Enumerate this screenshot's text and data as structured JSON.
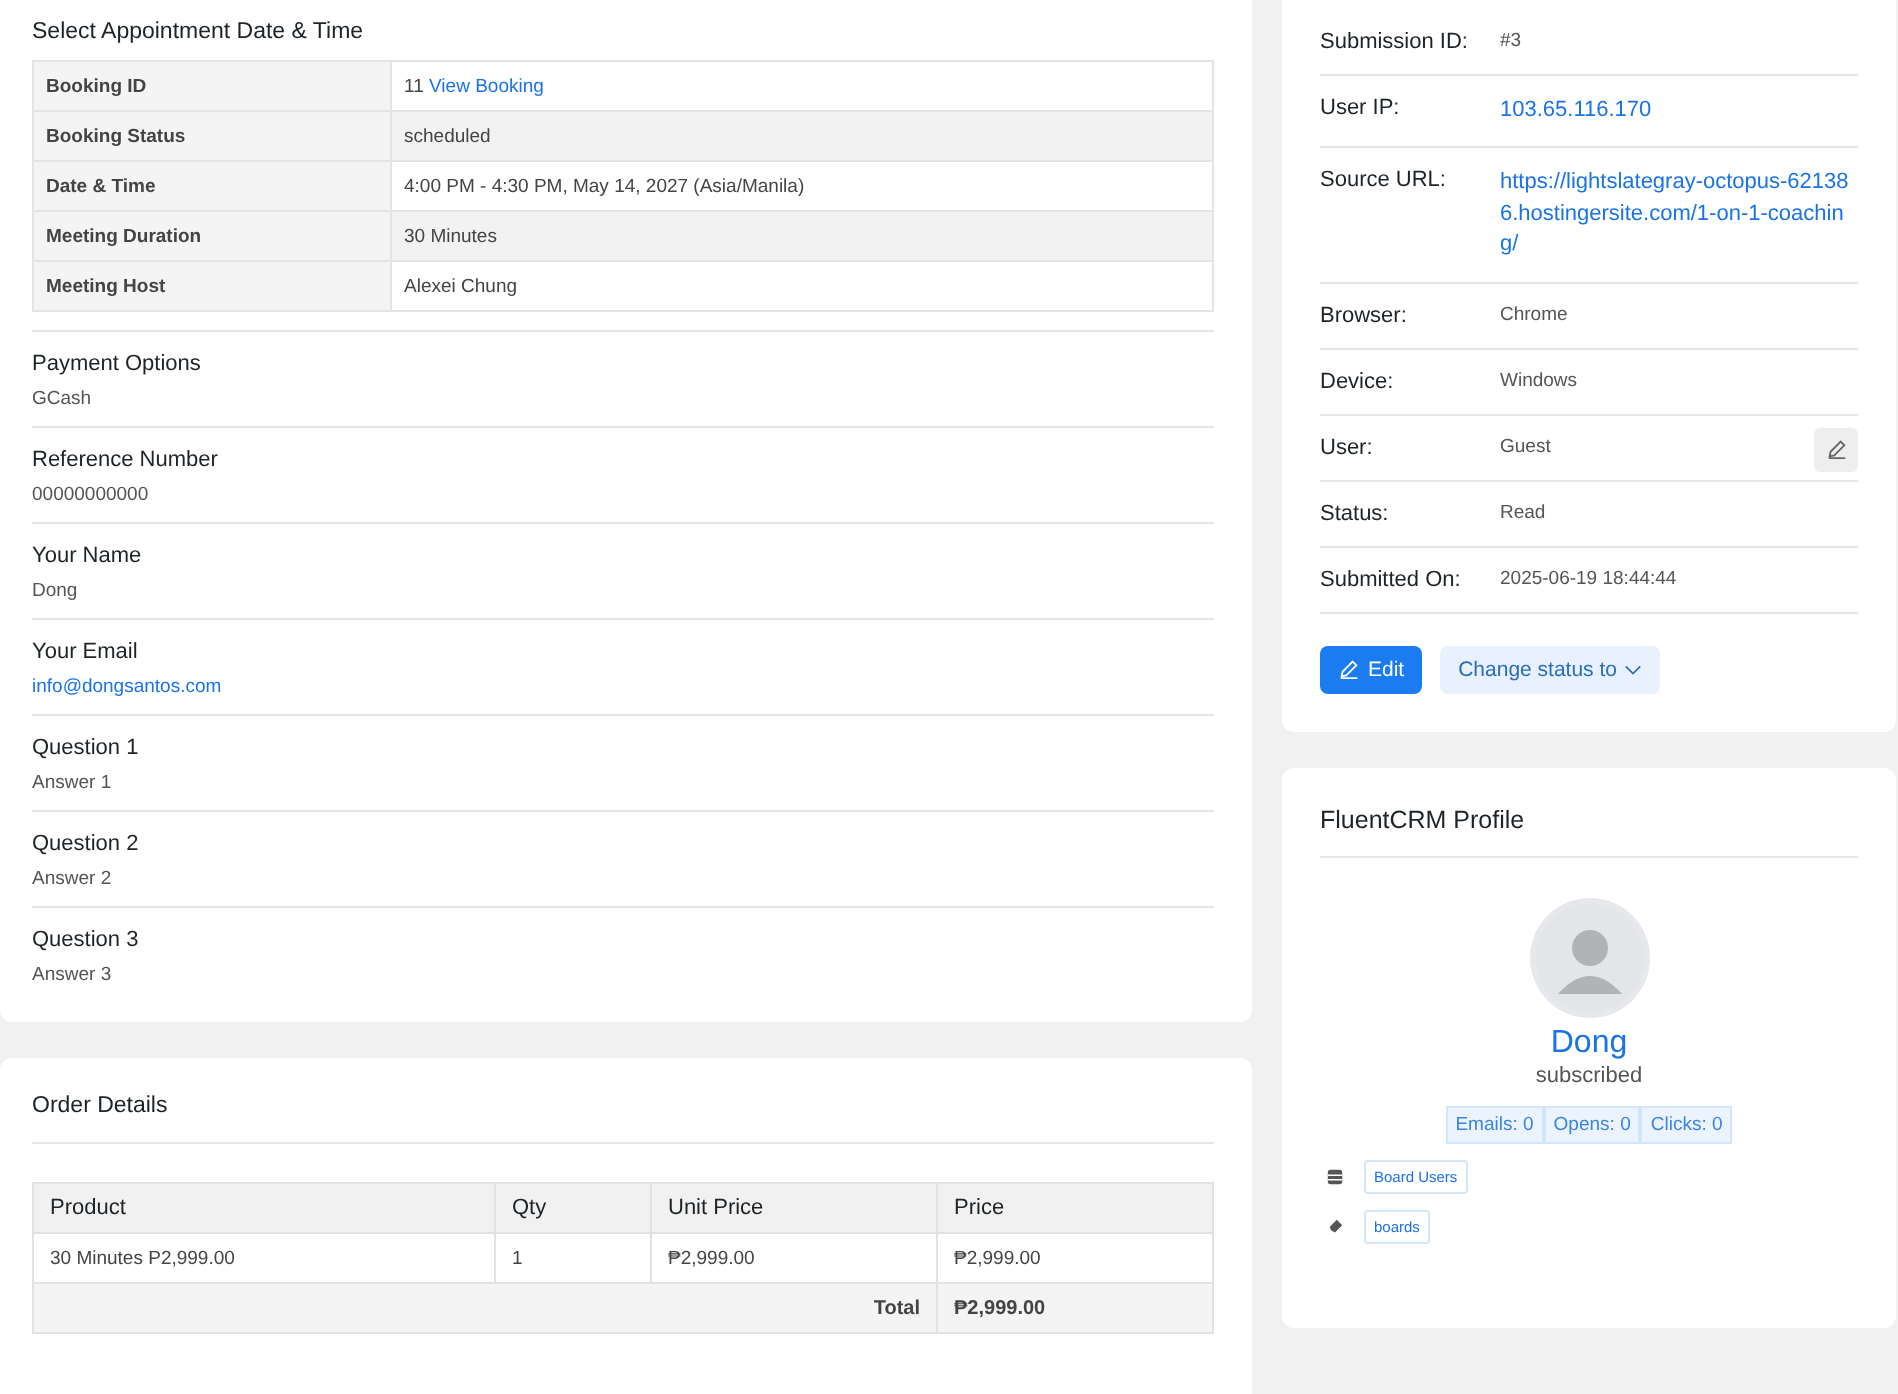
{
  "appointment": {
    "title": "Select Appointment Date & Time",
    "rows": [
      {
        "label": "Booking ID",
        "value": "11",
        "link": "View Booking"
      },
      {
        "label": "Booking Status",
        "value": "scheduled"
      },
      {
        "label": "Date & Time",
        "value": "4:00 PM - 4:30 PM, May 14, 2027 (Asia/Manila)"
      },
      {
        "label": "Meeting Duration",
        "value": "30 Minutes"
      },
      {
        "label": "Meeting Host",
        "value": "Alexei Chung"
      }
    ]
  },
  "fields": [
    {
      "label": "Payment Options",
      "value": "GCash",
      "kind": "text"
    },
    {
      "label": "Reference Number",
      "value": "00000000000",
      "kind": "text"
    },
    {
      "label": "Your Name",
      "value": "Dong",
      "kind": "text"
    },
    {
      "label": "Your Email",
      "value": "info@dongsantos.com",
      "kind": "link"
    },
    {
      "label": "Question 1",
      "value": "Answer 1",
      "kind": "text"
    },
    {
      "label": "Question 2",
      "value": "Answer 2",
      "kind": "text"
    },
    {
      "label": "Question 3",
      "value": "Answer 3",
      "kind": "text"
    }
  ],
  "order": {
    "title": "Order Details",
    "columns": [
      "Product",
      "Qty",
      "Unit Price",
      "Price"
    ],
    "rows": [
      [
        "30 Minutes P2,999.00",
        "1",
        "₱2,999.00",
        "₱2,999.00"
      ]
    ],
    "total_label": "Total",
    "total": "₱2,999.00"
  },
  "submission": {
    "rows": [
      {
        "label": "Submission ID:",
        "value": "#3",
        "kind": "text"
      },
      {
        "label": "User IP:",
        "value": "103.65.116.170",
        "kind": "link"
      },
      {
        "label": "Source URL:",
        "value": "https://lightslategray-octopus-621386.hostingersite.com/1-on-1-coaching/",
        "kind": "link"
      },
      {
        "label": "Browser:",
        "value": "Chrome",
        "kind": "text"
      },
      {
        "label": "Device:",
        "value": "Windows",
        "kind": "text"
      },
      {
        "label": "User:",
        "value": "Guest",
        "kind": "editable"
      },
      {
        "label": "Status:",
        "value": "Read",
        "kind": "text"
      },
      {
        "label": "Submitted On:",
        "value": "2025-06-19 18:44:44",
        "kind": "text"
      }
    ],
    "edit_button": "Edit",
    "status_button": "Change status to"
  },
  "profile": {
    "title": "FluentCRM Profile",
    "name": "Dong",
    "status": "subscribed",
    "stats": [
      "Emails: 0",
      "Opens: 0",
      "Clicks: 0"
    ],
    "lists": [
      "Board Users"
    ],
    "tags": [
      "boards"
    ]
  }
}
